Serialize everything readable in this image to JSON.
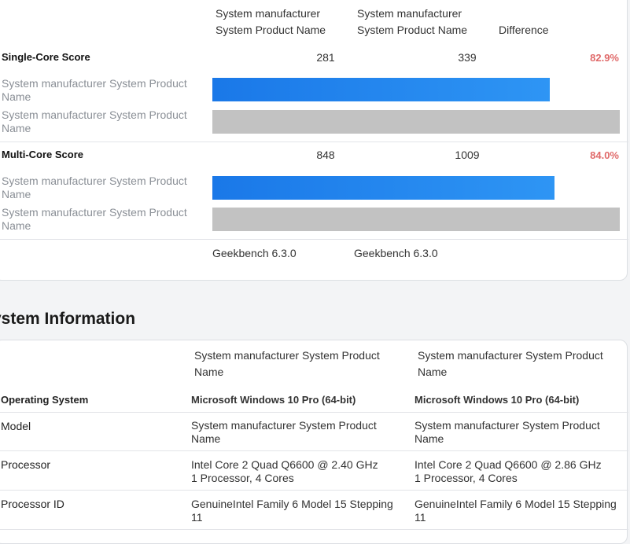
{
  "comparison": {
    "devices": [
      {
        "line1": "System manufacturer",
        "line2": "System Product Name"
      },
      {
        "line1": "System manufacturer",
        "line2": "System Product Name"
      }
    ],
    "difference_label": "Difference",
    "device_row_label": {
      "line1": "System manufacturer System Product",
      "line2": "Name"
    },
    "single_core": {
      "title": "Single-Core Score",
      "scores": [
        "281",
        "339"
      ],
      "difference": "82.9%",
      "bar_fractions": [
        0.829,
        1.0
      ]
    },
    "multi_core": {
      "title": "Multi-Core Score",
      "scores": [
        "848",
        "1009"
      ],
      "difference": "84.0%",
      "bar_fractions": [
        0.84,
        1.0
      ]
    },
    "versions": [
      "Geekbench 6.3.0",
      "Geekbench 6.3.0"
    ],
    "colors": {
      "bar_primary": "#1a78e8",
      "bar_secondary": "#c2c2c2",
      "difference": "#e06a6a"
    }
  },
  "system_info": {
    "title": "ystem Information",
    "devices": [
      "System manufacturer System Product Name",
      "System manufacturer System Product Name"
    ],
    "rows": [
      {
        "key": "Operating System",
        "values": [
          "Microsoft Windows 10 Pro (64-bit)",
          "Microsoft Windows 10 Pro (64-bit)"
        ]
      },
      {
        "key": "Model",
        "values": [
          "System manufacturer System Product Name",
          "System manufacturer System Product Name"
        ]
      },
      {
        "key": "Processor",
        "values": [
          "Intel Core 2 Quad Q6600 @ 2.40 GHz\n1 Processor, 4 Cores",
          "Intel Core 2 Quad Q6600 @ 2.86 GHz\n1 Processor, 4 Cores"
        ]
      },
      {
        "key": "Processor ID",
        "values": [
          "GenuineIntel Family 6 Model 15 Stepping 11",
          "GenuineIntel Family 6 Model 15 Stepping 11"
        ]
      }
    ]
  }
}
